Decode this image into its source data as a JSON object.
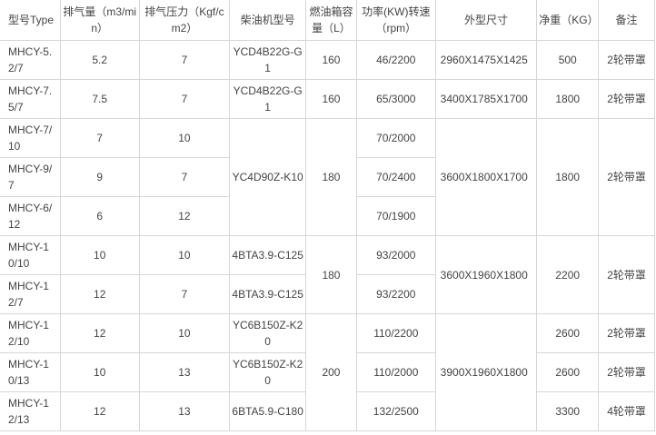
{
  "headers": {
    "model": "型号Type",
    "flow": "排气量（m3/min）",
    "pressure": "排气压力（Kgf/cm2）",
    "engine": "柴油机型号",
    "tank": "燃油箱容量（L）",
    "power": "功率(KW)转速（rpm）",
    "dimensions": "外型尺寸",
    "weight": "净重（KG）",
    "note": "备注"
  },
  "rows": [
    {
      "model": "MHCY-5.2/7",
      "flow": "5.2",
      "pressure": "7",
      "engine": "YCD4B22G-G1",
      "tank": "160",
      "power": "46/2200",
      "dimensions": "2960X1475X1425",
      "weight": "500",
      "note": "2轮带罩"
    },
    {
      "model": "MHCY-7.5/7",
      "flow": "7.5",
      "pressure": "7",
      "engine": "YCD4B22G-G1",
      "tank": "160",
      "power": "65/3000",
      "dimensions": "3400X1785X1700",
      "weight": "1800",
      "note": "2轮带罩"
    },
    {
      "model": "MHCY-7/10",
      "flow": "7",
      "pressure": "10",
      "engine": "YC4D90Z-K10",
      "tank": "180",
      "power": "70/2000",
      "dimensions": "3600X1800X1700",
      "weight": "1800",
      "note": "2轮带罩"
    },
    {
      "model": "MHCY-9/7",
      "flow": "9",
      "pressure": "7",
      "power": "70/2400"
    },
    {
      "model": "MHCY-6/12",
      "flow": "6",
      "pressure": "12",
      "power": "70/1900"
    },
    {
      "model": "MHCY-10/10",
      "flow": "10",
      "pressure": "10",
      "engine": "4BTA3.9-C125",
      "tank": "180",
      "power": "93/2000",
      "dimensions": "3600X1960X1800",
      "weight": "2200",
      "note": "2轮带罩"
    },
    {
      "model": "MHCY-12/7",
      "flow": "12",
      "pressure": "7",
      "engine": "4BTA3.9-C125",
      "power": "93/2200"
    },
    {
      "model": "MHCY-12/10",
      "flow": "12",
      "pressure": "10",
      "engine": "YC6B150Z-K20",
      "tank": "200",
      "power": "110/2200",
      "dimensions": "3900X1960X1800",
      "weight": "2600",
      "note": "2轮带罩"
    },
    {
      "model": "MHCY-10/13",
      "flow": "10",
      "pressure": "13",
      "engine": "YC6B150Z-K20",
      "power": "110/2000",
      "weight": "2600",
      "note": "2轮带罩"
    },
    {
      "model": "MHCY-12/13",
      "flow": "12",
      "pressure": "13",
      "engine": "6BTA5.9-C180",
      "power": "132/2500",
      "weight": "3300",
      "note": "4轮带罩"
    }
  ]
}
